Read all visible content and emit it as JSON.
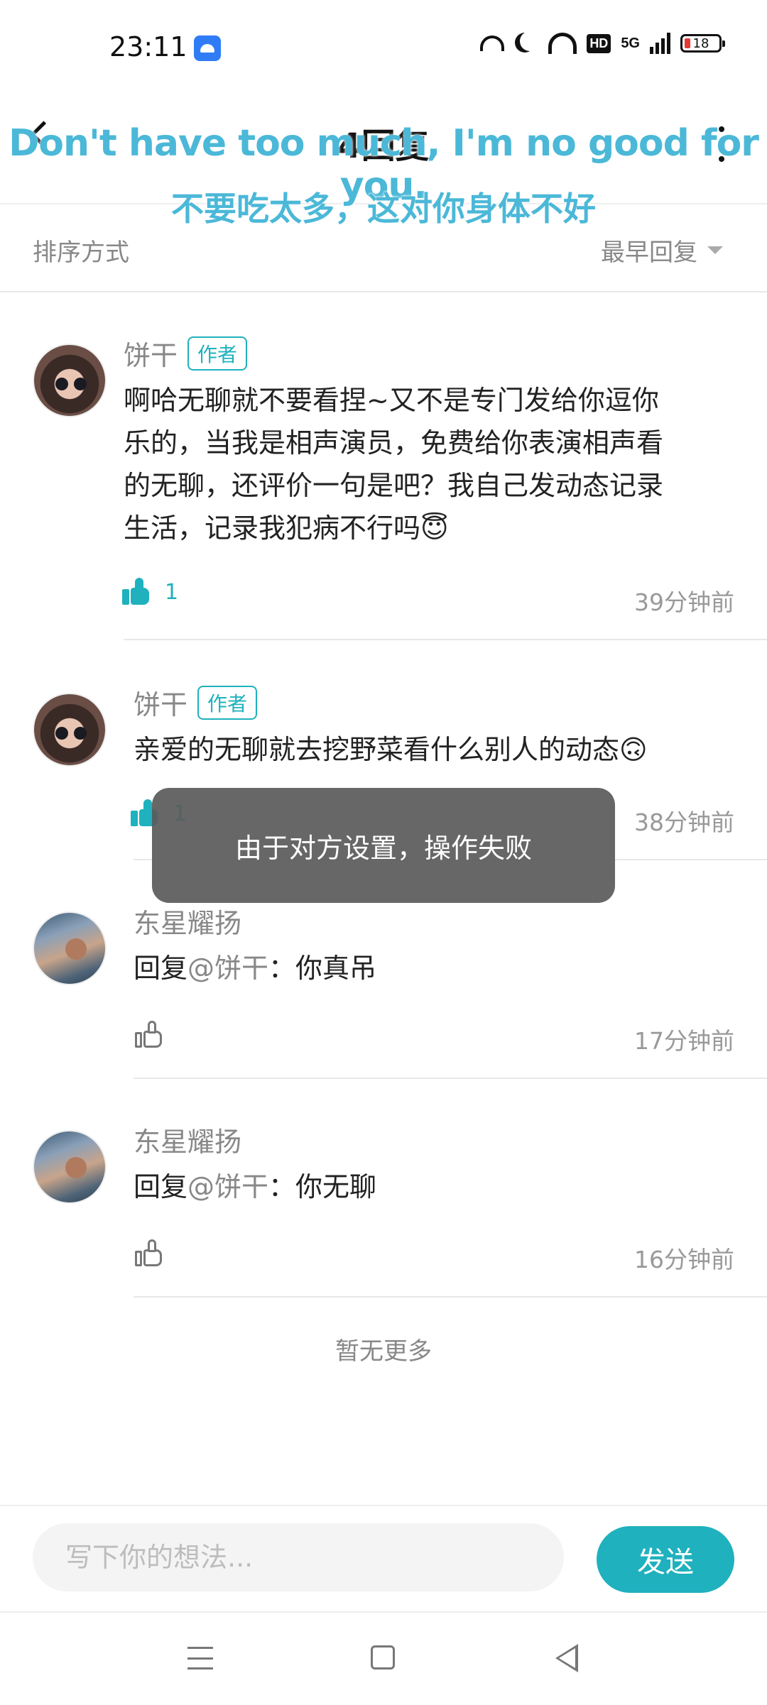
{
  "status_bar": {
    "time": "23:11",
    "network": "5G",
    "hd_badge": "HD",
    "battery": "18"
  },
  "header": {
    "title": "4回复"
  },
  "subtitles": {
    "english": "Don't have too much, I'm no good for you.",
    "chinese": "不要吃太多，这对你身体不好"
  },
  "sort": {
    "label": "排序方式",
    "value": "最早回复"
  },
  "author_badge": "作者",
  "comments": [
    {
      "username": "饼干",
      "is_author": true,
      "lines": [
        "啊哈无聊就不要看捏~又不是专门发给你逗你",
        "乐的，当我是相声演员，免费给你表演相声看",
        "的无聊，还评价一句是吧？我自己发动态记录",
        "生活，记录我犯病不行吗😇"
      ],
      "likes": "1",
      "liked": true,
      "time": "39分钟前"
    },
    {
      "username": "饼干",
      "is_author": true,
      "text": "亲爱的无聊就去挖野菜看什么别人的动态🙃",
      "likes": "1",
      "liked": true,
      "time": "38分钟前"
    },
    {
      "username": "东星耀扬",
      "is_author": false,
      "reply_prefix": "回复",
      "mention": "@饼干",
      "reply_text": "：你真吊",
      "liked": false,
      "time": "17分钟前"
    },
    {
      "username": "东星耀扬",
      "is_author": false,
      "reply_prefix": "回复",
      "mention": "@饼干",
      "reply_text": "：你无聊",
      "liked": false,
      "time": "16分钟前"
    }
  ],
  "no_more": "暂无更多",
  "toast": "由于对方设置，操作失败",
  "input": {
    "placeholder": "写下你的想法..."
  },
  "send_button": "发送",
  "colors": {
    "accent": "#1fb1bd",
    "subtitle": "#4bb8d8",
    "toast_bg": "#5a5a5a"
  }
}
